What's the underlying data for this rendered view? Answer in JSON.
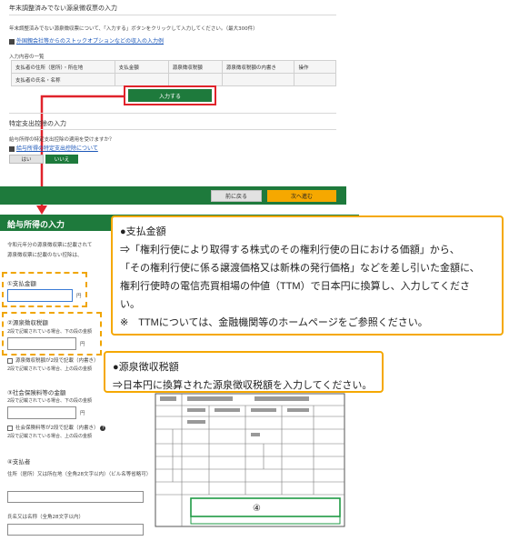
{
  "top": {
    "section_title": "年末調整済みでない源泉徴収票の入力",
    "description": "年末調整済みでない源泉徴収票について、「入力する」ボタンをクリックして入力してください。（最大300件）",
    "link": "外国親会社等からのストックオプションなどの収入の入力例",
    "list_heading": "入力内容の一覧",
    "table_headers": [
      "支払者の住所（居所）・所在地",
      "支払金額",
      "源泉徴収税額",
      "源泉徴収税額の内書き",
      "操作"
    ],
    "table_subheader": "支払者の氏名・名称",
    "input_button": "入力する"
  },
  "special": {
    "section_title": "特定支出控除の入力",
    "question": "給与所得の特定支出控除の適用を受けますか？",
    "link": "給与所得の特定支出控除について",
    "yes": "はい",
    "no": "いいえ"
  },
  "footer_bar": {
    "back": "前に戻る",
    "next": "次へ進む"
  },
  "form": {
    "title": "給与所得の入力",
    "intro_1": "令和元年分の源泉徴収票に記載されて",
    "intro_2": "源泉徴収票に記載のない控除は、",
    "payment_label": "①支払金額",
    "payment_unit": "円",
    "tax_label": "②源泉徴収税額",
    "tax_note": "2段で記載されている場合、下の段の金額",
    "tax_unit": "円",
    "tax_check": "源泉徴収税額が2段で記載（内書き）",
    "tax_check_note": "2段で記載されている場合、上の段の金額",
    "social_label": "③社会保険料等の金額",
    "social_note": "2段で記載されている場合、下の段の金額",
    "social_unit": "円",
    "social_check": "社会保険料等が2段で記載（内書き）",
    "social_check_note": "2段で記載されている場合、上の段の金額",
    "payer_label": "④支払者",
    "payer_address": "住所（居所）又は所在地（全角28文字以内）（ビル名等省略可）",
    "payer_name": "氏名又は名称（全角28文字以内）"
  },
  "callouts": {
    "amount_title": "●支払金額",
    "amount_lines": [
      "⇒「権利行使により取得する株式のその権利行使の日における価額」から、",
      "「その権利行使に係る譲渡価格又は新株の発行価格」などを差し引いた金額に、",
      "権利行使時の電信売買相場の仲値（TTM）で日本円に換算し、入力してくださ",
      "い。",
      "※　TTMについては、金融機関等のホームページをご参照ください。"
    ],
    "tax_title": "●源泉徴収税額",
    "tax_line": "⇒日本円に換算された源泉徴収税額を入力してください。"
  },
  "slip": {
    "marker": "④"
  },
  "colors": {
    "green": "#1e7a3c",
    "red": "#e0232b",
    "orange": "#f5a800"
  }
}
